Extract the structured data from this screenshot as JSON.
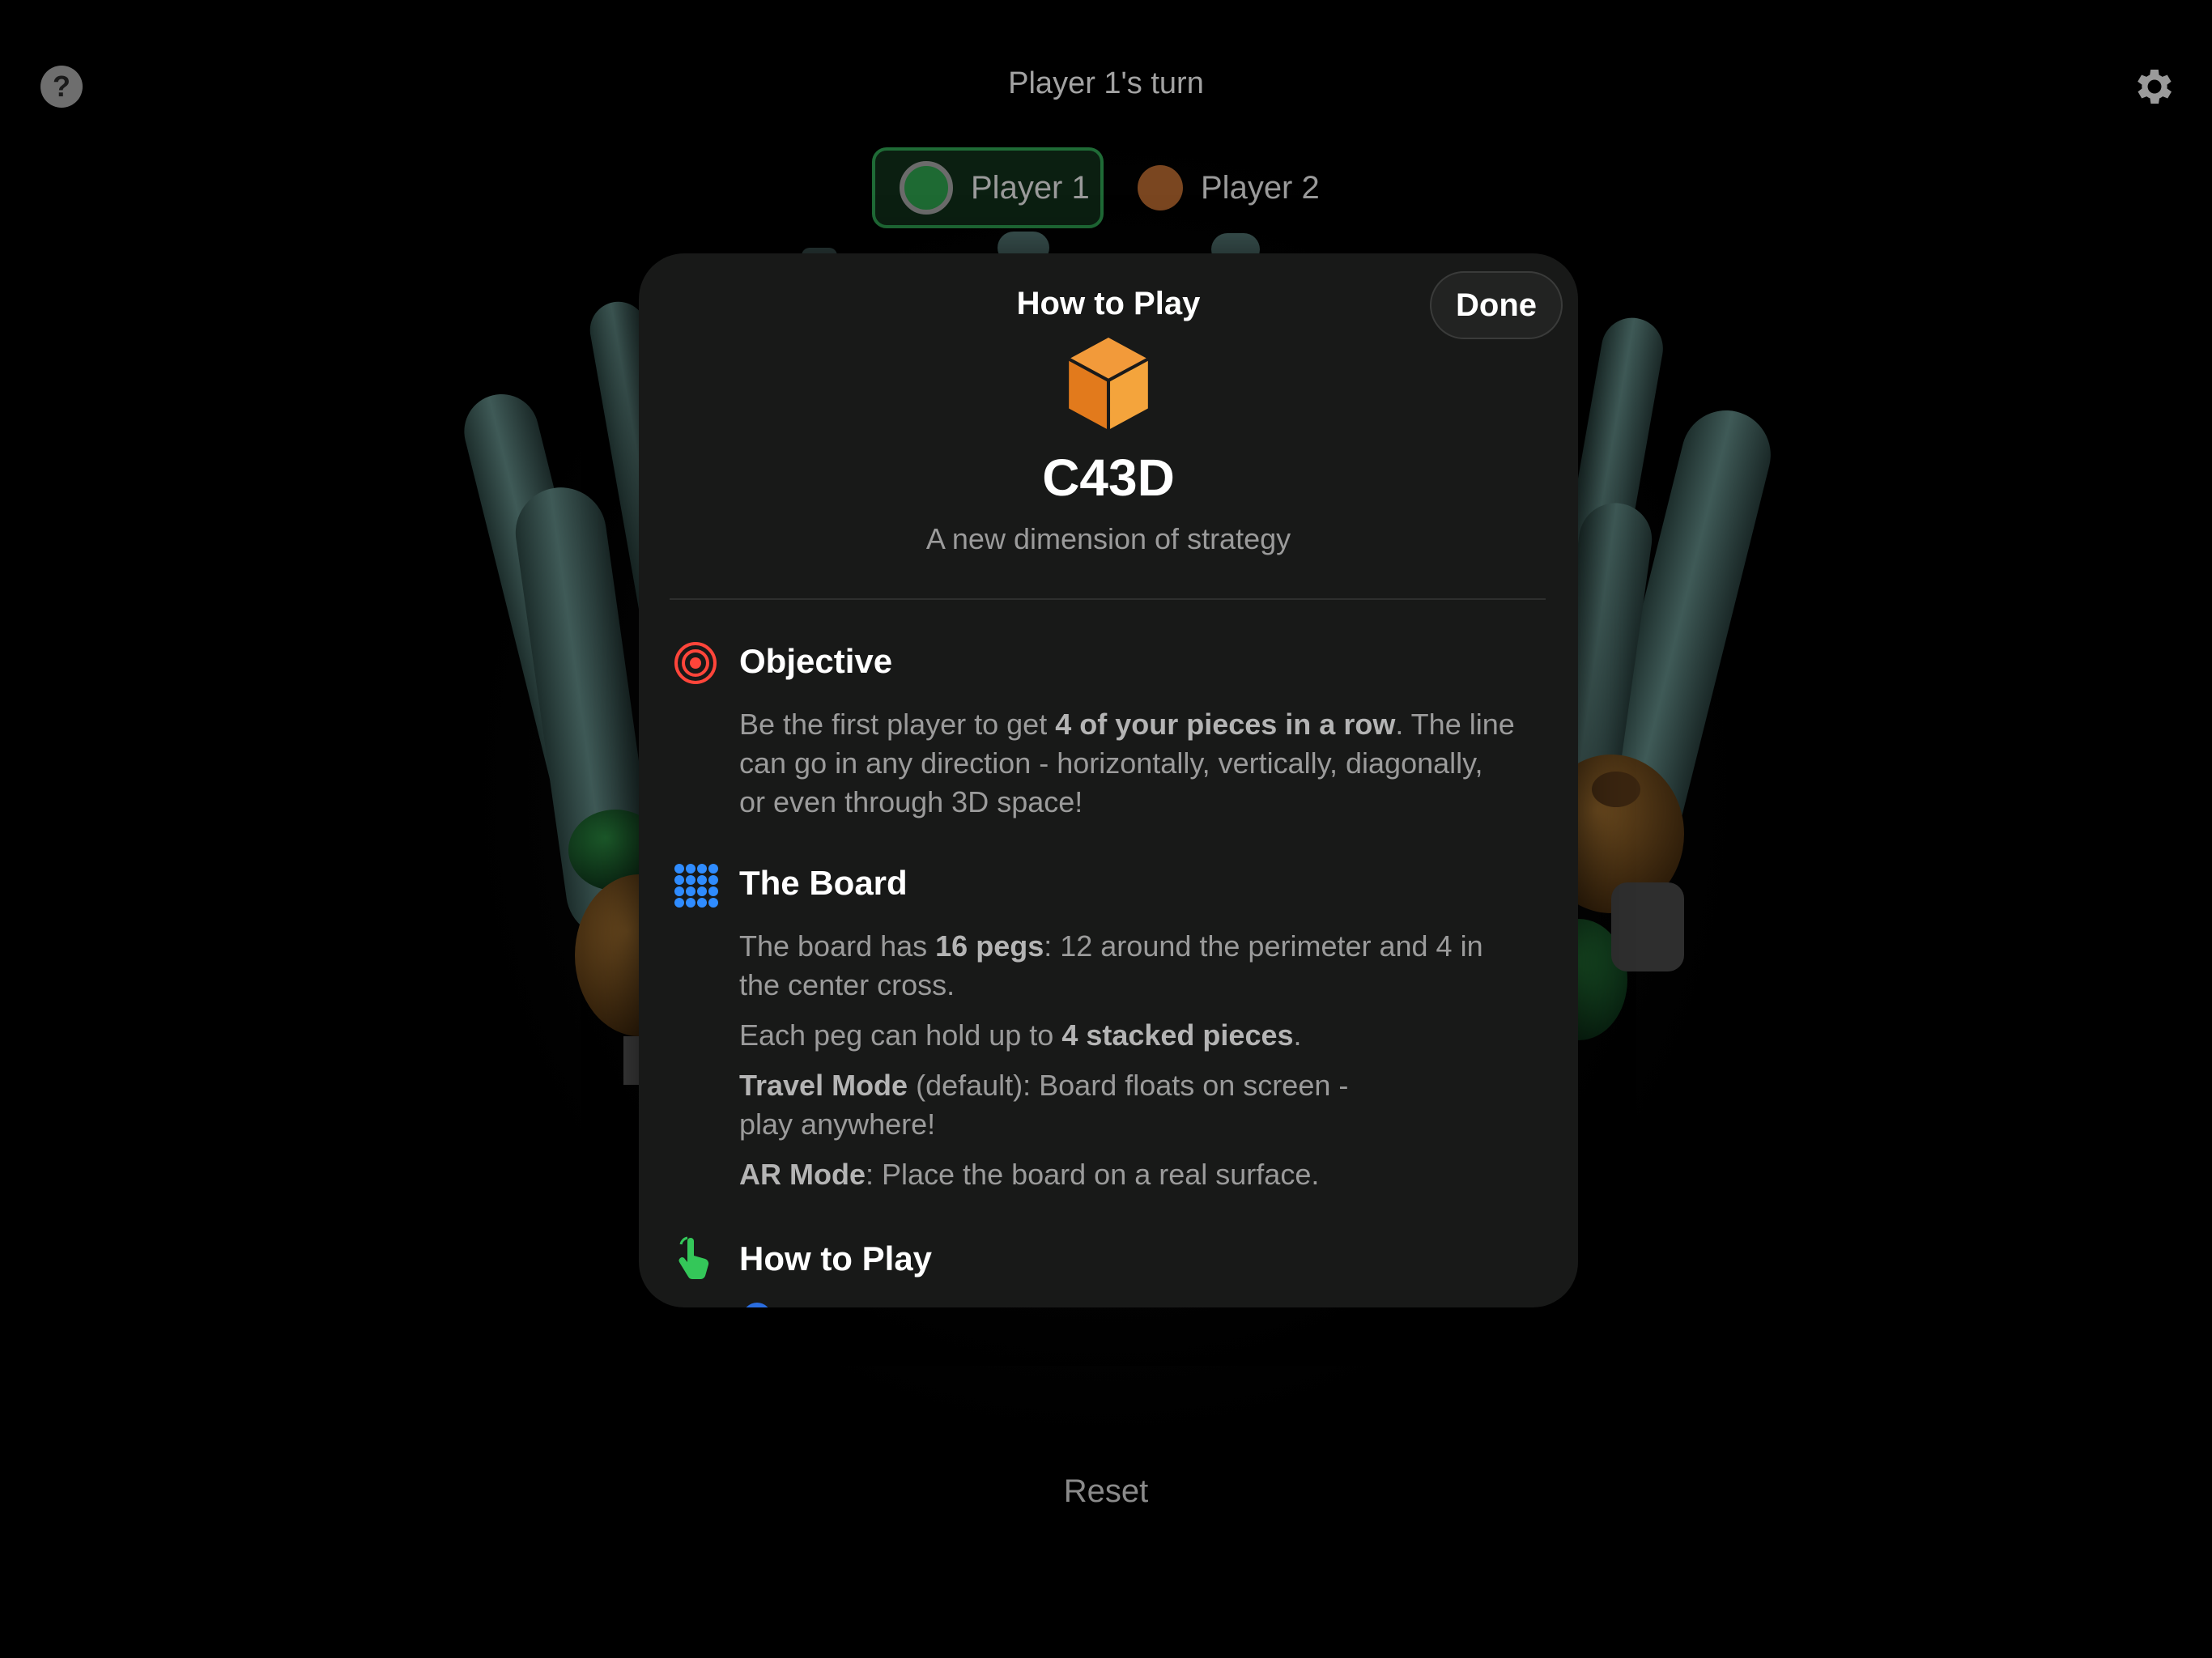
{
  "header": {
    "turn_text": "Player 1's turn",
    "help_icon": "question-mark-icon",
    "help_label": "?",
    "settings_icon": "gear-icon"
  },
  "players": [
    {
      "label": "Player 1",
      "color": "#1e6a33",
      "active": true
    },
    {
      "label": "Player 2",
      "color": "#7a4620",
      "active": false
    }
  ],
  "footer": {
    "reset_label": "Reset"
  },
  "modal": {
    "title": "How to Play",
    "done_label": "Done",
    "app_icon": "orange-cube-icon",
    "app_name": "C43D",
    "tagline": "A new dimension of strategy",
    "sections": {
      "objective": {
        "icon": "target-icon",
        "icon_color": "#ff453a",
        "heading": "Objective",
        "p1_a": "Be the first player to get ",
        "p1_b": "4 of your pieces in a row",
        "p1_c": ". The line",
        "p1_d": "can go in any direction - horizontally, vertically, diagonally,",
        "p1_e": "or even through 3D space!"
      },
      "board": {
        "icon": "grid-dots-icon",
        "icon_color": "#2f8cff",
        "heading": "The Board",
        "p1_a": "The board has ",
        "p1_b": "16 pegs",
        "p1_c": ": 12 around the perimeter and 4 in",
        "p1_d": "the center cross.",
        "p2_a": "Each peg can hold up to ",
        "p2_b": "4 stacked pieces",
        "p2_c": ".",
        "p3_a": "Travel Mode",
        "p3_b": " (default): Board floats on screen -",
        "p3_c": "play anywhere!",
        "p4_a": "AR Mode",
        "p4_b": ": Place the board on a real surface."
      },
      "how_to_play": {
        "icon": "hand-tap-icon",
        "icon_color": "#34c759",
        "heading": "How to Play"
      }
    }
  }
}
